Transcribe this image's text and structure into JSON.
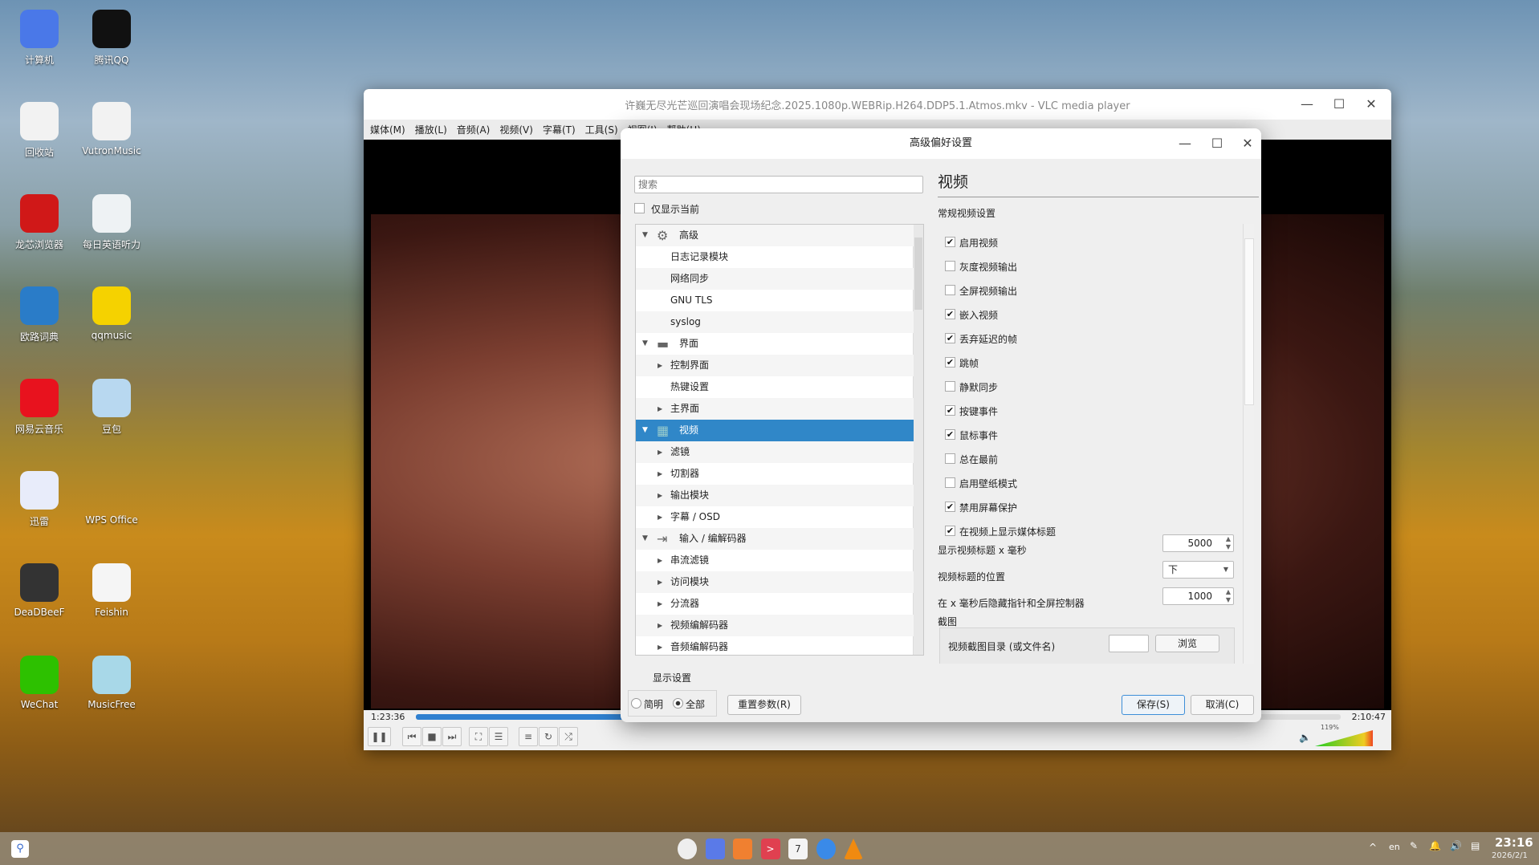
{
  "desktop": {
    "icons": [
      {
        "label": "计算机",
        "icon": "computer-icon",
        "color": "#4a78e8"
      },
      {
        "label": "腾讯QQ",
        "icon": "qq-icon",
        "color": "#111"
      },
      {
        "label": "回收站",
        "icon": "recycle-bin-icon",
        "color": "#f2f2f2"
      },
      {
        "label": "VutronMusic",
        "icon": "music-note-icon",
        "color": "#f2f2f2"
      },
      {
        "label": "龙芯浏览器",
        "icon": "loongson-browser-icon",
        "color": "#d01818"
      },
      {
        "label": "每日英语听力",
        "icon": "english-listening-icon",
        "color": "#eef2f4"
      },
      {
        "label": "欧路词典",
        "icon": "dictionary-icon",
        "color": "#2a7cc8"
      },
      {
        "label": "qqmusic",
        "icon": "qqmusic-icon",
        "color": "#f5d200"
      },
      {
        "label": "网易云音乐",
        "icon": "netease-music-icon",
        "color": "#e8121e"
      },
      {
        "label": "豆包",
        "icon": "doubao-icon",
        "color": "#b8d8f0"
      },
      {
        "label": "迅雷",
        "icon": "xunlei-icon",
        "color": "#e8ecfa"
      },
      {
        "label": "WPS Office",
        "icon": "wps-icon",
        "color": "transparent"
      },
      {
        "label": "DeaDBeeF",
        "icon": "deadbeef-icon",
        "color": "#333"
      },
      {
        "label": "Feishin",
        "icon": "feishin-icon",
        "color": "#f5f5f5"
      },
      {
        "label": "WeChat",
        "icon": "wechat-icon",
        "color": "#2dc100"
      },
      {
        "label": "MusicFree",
        "icon": "musicfree-icon",
        "color": "#a8d8e8"
      }
    ]
  },
  "vlc": {
    "title": "许巍无尽光芒巡回演唱会现场纪念.2025.1080p.WEBRip.H264.DDP5.1.Atmos.mkv - VLC media player",
    "menu": [
      "媒体(M)",
      "播放(L)",
      "音频(A)",
      "视频(V)",
      "字幕(T)",
      "工具(S)",
      "视图(I)",
      "帮助(H)"
    ],
    "elapsed": "1:23:36",
    "total": "2:10:47",
    "progress": 0.639,
    "volume": "119%",
    "volume_level": 1.19
  },
  "dialog": {
    "title": "高级偏好设置",
    "search_placeholder": "搜索",
    "show_current_only": "仅显示当前",
    "tree": [
      {
        "label": "高级",
        "level": 0,
        "expanded": true,
        "icon": "gear-icon"
      },
      {
        "label": "日志记录模块",
        "level": 1
      },
      {
        "label": "网络同步",
        "level": 1
      },
      {
        "label": "GNU TLS",
        "level": 1
      },
      {
        "label": "syslog",
        "level": 1
      },
      {
        "label": "界面",
        "level": 0,
        "expanded": true,
        "icon": "paint-roller-icon"
      },
      {
        "label": "控制界面",
        "level": 1,
        "arrow": true
      },
      {
        "label": "热键设置",
        "level": 1
      },
      {
        "label": "主界面",
        "level": 1,
        "arrow": true
      },
      {
        "label": "视频",
        "level": 0,
        "expanded": true,
        "icon": "video-icon",
        "selected": true
      },
      {
        "label": "滤镜",
        "level": 1,
        "arrow": true
      },
      {
        "label": "切割器",
        "level": 1,
        "arrow": true
      },
      {
        "label": "输出模块",
        "level": 1,
        "arrow": true
      },
      {
        "label": "字幕 / OSD",
        "level": 1,
        "arrow": true
      },
      {
        "label": "输入 / 编解码器",
        "level": 0,
        "expanded": true,
        "icon": "codec-icon"
      },
      {
        "label": "串流滤镜",
        "level": 1,
        "arrow": true
      },
      {
        "label": "访问模块",
        "level": 1,
        "arrow": true
      },
      {
        "label": "分流器",
        "level": 1,
        "arrow": true
      },
      {
        "label": "视频编解码器",
        "level": 1,
        "arrow": true
      },
      {
        "label": "音频编解码器",
        "level": 1,
        "arrow": true
      }
    ],
    "panel_title": "视频",
    "section": "常规视频设置",
    "options": [
      {
        "label": "启用视频",
        "checked": true
      },
      {
        "label": "灰度视频输出",
        "checked": false
      },
      {
        "label": "全屏视频输出",
        "checked": false
      },
      {
        "label": "嵌入视频",
        "checked": true
      },
      {
        "label": "丢弃延迟的帧",
        "checked": true
      },
      {
        "label": "跳帧",
        "checked": true
      },
      {
        "label": "静默同步",
        "checked": false
      },
      {
        "label": "按键事件",
        "checked": true
      },
      {
        "label": "鼠标事件",
        "checked": true
      },
      {
        "label": "总在最前",
        "checked": false
      },
      {
        "label": "启用壁纸模式",
        "checked": false
      },
      {
        "label": "禁用屏幕保护",
        "checked": true
      },
      {
        "label": "在视频上显示媒体标题",
        "checked": true
      }
    ],
    "title_ms_label": "显示视频标题 x 毫秒",
    "title_ms": "5000",
    "title_pos_label": "视频标题的位置",
    "title_pos": "下",
    "hide_ms_label": "在 x 毫秒后隐藏指针和全屏控制器",
    "hide_ms": "1000",
    "snapshot_label": "截图",
    "snapshot_dir_label": "视频截图目录 (或文件名)",
    "browse": "浏览",
    "display_settings": "显示设置",
    "simple": "简明",
    "all": "全部",
    "reset": "重置参数(R)",
    "save": "保存(S)",
    "cancel": "取消(C)"
  },
  "taskbar": {
    "apps": [
      "launcher-icon",
      "file-manager-icon",
      "app-store-icon",
      "terminal-icon",
      "calendar-icon",
      "browser-icon",
      "vlc-icon"
    ],
    "calendar_day": "7",
    "lang": "en",
    "time": "23:16",
    "date": "2026/2/1"
  }
}
